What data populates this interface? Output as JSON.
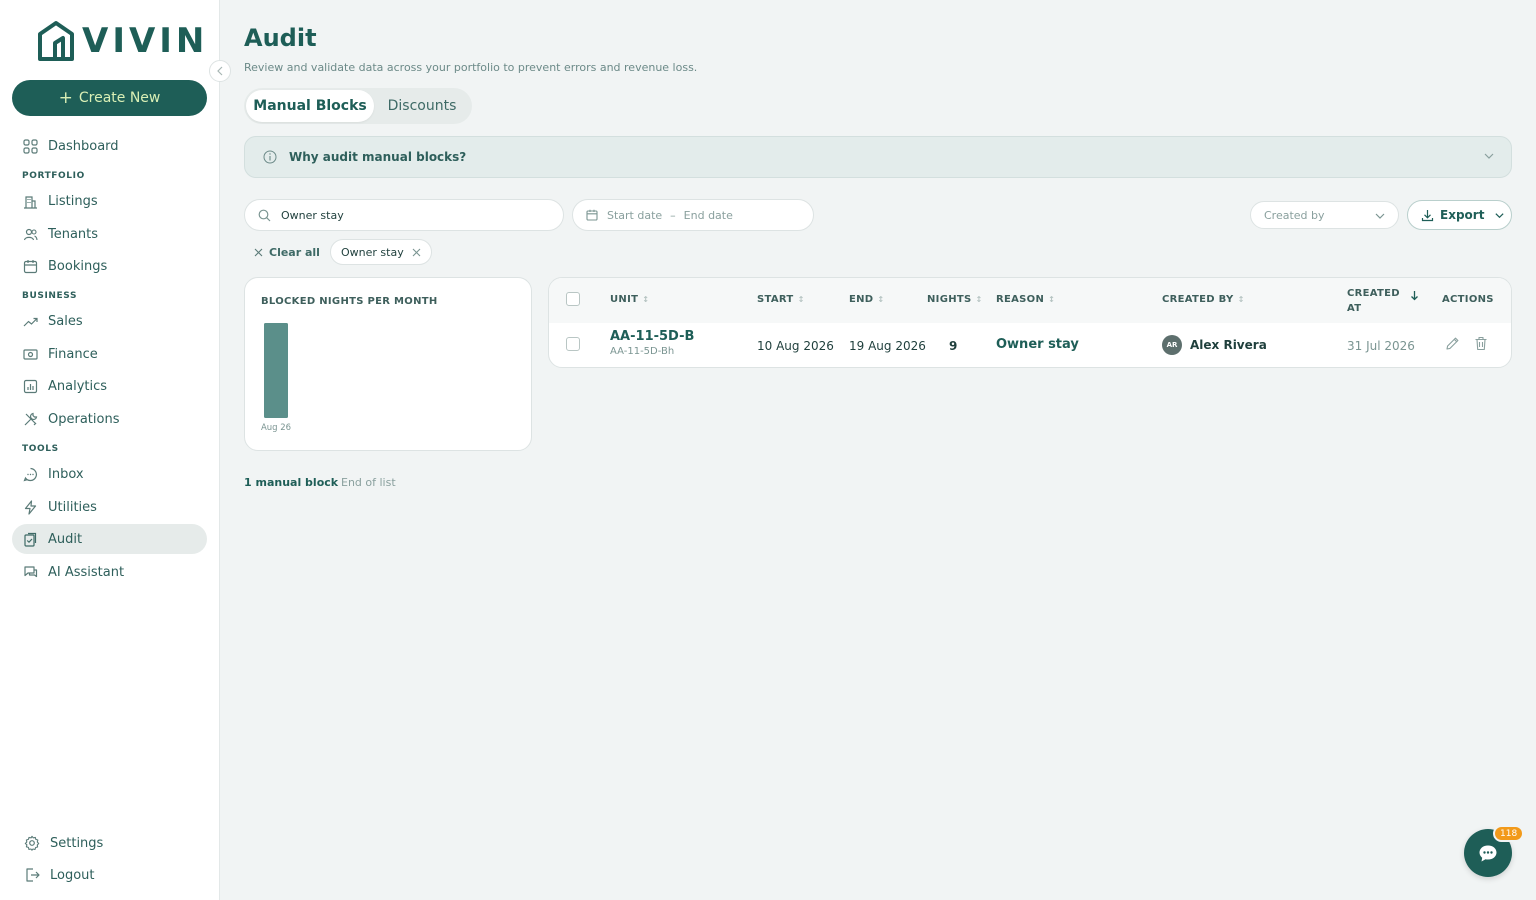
{
  "app": {
    "logo_text": "VIVIN"
  },
  "sidebar": {
    "create_label": "Create New",
    "sections": {
      "portfolio": "PORTFOLIO",
      "business": "BUSINESS",
      "tools": "TOOLS"
    },
    "items": {
      "dashboard": "Dashboard",
      "listings": "Listings",
      "tenants": "Tenants",
      "bookings": "Bookings",
      "sales": "Sales",
      "finance": "Finance",
      "analytics": "Analytics",
      "operations": "Operations",
      "inbox": "Inbox",
      "utilities": "Utilities",
      "audit": "Audit",
      "ai_assistant": "AI Assistant",
      "settings": "Settings",
      "logout": "Logout"
    },
    "active_item": "Audit"
  },
  "header": {
    "title": "Audit",
    "subtitle": "Review and validate data across your portfolio to prevent errors and revenue loss."
  },
  "tabs": [
    {
      "label": "Manual Blocks",
      "active": true
    },
    {
      "label": "Discounts",
      "active": false
    }
  ],
  "info_banner": {
    "text": "Why audit manual blocks?"
  },
  "filters": {
    "search_value": "Owner stay",
    "date_start_placeholder": "Start date",
    "date_sep": "–",
    "date_end_placeholder": "End date",
    "created_by_placeholder": "Created by",
    "export_label": "Export",
    "clear_all": "Clear all",
    "active_chip": "Owner stay"
  },
  "chart_data": {
    "type": "bar",
    "title": "BLOCKED NIGHTS PER MONTH",
    "categories": [
      "Aug 26"
    ],
    "values": [
      9
    ],
    "ylim": [
      0,
      9
    ],
    "color": "#5b8f8a"
  },
  "table": {
    "headers": {
      "unit": "UNIT",
      "start": "START",
      "end": "END",
      "nights": "NIGHTS",
      "reason": "REASON",
      "created_by": "CREATED BY",
      "created_at_line1": "CREATED",
      "created_at_line2": "AT",
      "actions": "ACTIONS"
    },
    "rows": [
      {
        "unit": "AA-11-5D-B",
        "unit_sub": "AA-11-5D-Bh",
        "start": "10 Aug 2026",
        "end": "19 Aug 2026",
        "nights": "9",
        "reason": "Owner stay",
        "creator_initials": "AR",
        "created_by": "Alex Rivera",
        "created_at": "31 Jul 2026"
      }
    ]
  },
  "footer": {
    "count": "1 manual block",
    "end_text": "End of list"
  },
  "chat": {
    "badge": "118"
  },
  "colors": {
    "brand": "#1e5e57",
    "accent": "#d9efb5",
    "badge": "#f29a1a"
  }
}
